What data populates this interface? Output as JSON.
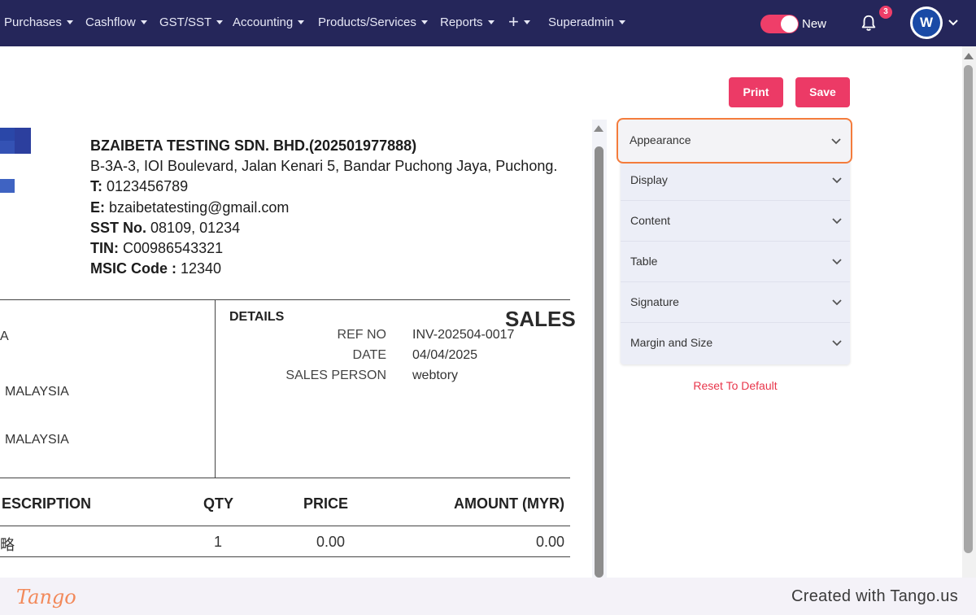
{
  "nav": {
    "items": [
      {
        "label": "Purchases"
      },
      {
        "label": "Cashflow"
      },
      {
        "label": "GST/SST"
      },
      {
        "label": "Accounting"
      },
      {
        "label": "Products/Services"
      },
      {
        "label": "Reports"
      },
      {
        "label": "+"
      },
      {
        "label": "Superadmin"
      }
    ],
    "toggle_label": "New",
    "notification_count": "3",
    "avatar_initial": "W"
  },
  "toolbar": {
    "print_label": "Print",
    "save_label": "Save"
  },
  "document": {
    "company_name": "BZAIBETA TESTING SDN. BHD.(202501977888)",
    "address": "B-3A-3, IOI Boulevard, Jalan Kenari 5, Bandar Puchong Jaya, Puchong.",
    "phone_label": "T:",
    "phone": "0123456789",
    "email_label": "E:",
    "email": "bzaibetatesting@gmail.com",
    "sst_label": "SST No.",
    "sst": "08109, 01234",
    "tin_label": "TIN:",
    "tin": "C00986543321",
    "msic_label": "MSIC Code :",
    "msic": "12340",
    "customer_lines": [
      "A",
      "MALAYSIA",
      "MALAYSIA"
    ],
    "details_title": "DETAILS",
    "doc_type": "SALES",
    "details": [
      {
        "label": "REF NO",
        "value": "INV-202504-0017"
      },
      {
        "label": "DATE",
        "value": "04/04/2025"
      },
      {
        "label": "SALES PERSON",
        "value": "webtory"
      }
    ],
    "table_headers": {
      "description": "ESCRIPTION",
      "qty": "QTY",
      "price": "PRICE",
      "amount": "AMOUNT (MYR)"
    },
    "rows": [
      {
        "description": "略",
        "qty": "1",
        "price": "0.00",
        "amount": "0.00"
      }
    ]
  },
  "settings": {
    "sections": [
      {
        "label": "Appearance"
      },
      {
        "label": "Display"
      },
      {
        "label": "Content"
      },
      {
        "label": "Table"
      },
      {
        "label": "Signature"
      },
      {
        "label": "Margin and Size"
      }
    ],
    "reset_label": "Reset To Default"
  },
  "footer": {
    "logo_text": "Tango",
    "credit": "Created with Tango.us"
  },
  "colors": {
    "nav_bg": "#25265a",
    "accent": "#ec3a66",
    "highlight": "#f47c3c",
    "logo_blue": "#2a47a8"
  }
}
